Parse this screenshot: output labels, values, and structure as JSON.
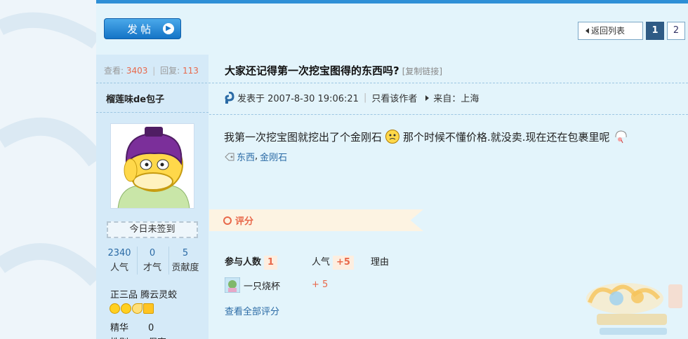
{
  "toolbar": {
    "post_label": "发帖",
    "back_label": "返回列表",
    "pages": [
      "1",
      "2"
    ],
    "current_page": "1"
  },
  "thread": {
    "stats": {
      "views_label": "查看:",
      "views": "3403",
      "replies_label": "回复:",
      "replies": "113"
    },
    "title": "大家还记得第一次挖宝图得的东西吗?",
    "copy_link": "[复制链接]"
  },
  "author": {
    "name": "榴莲味de包子",
    "checkin": "今日未签到",
    "stats": [
      {
        "value": "2340",
        "label": "人气"
      },
      {
        "value": "0",
        "label": "才气"
      },
      {
        "value": "5",
        "label": "贡献度"
      }
    ],
    "rank": "正三品 腾云灵蛟",
    "details": [
      {
        "label": "精华",
        "value": "0"
      },
      {
        "label": "性别",
        "value": "保密"
      }
    ]
  },
  "post": {
    "posted_at": "发表于 2007-8-30 19:06:21",
    "only_author": "只看该作者",
    "from": "来自：上海",
    "content_part1": "我第一次挖宝图就挖出了个金刚石",
    "content_part2": "那个时候不懂价格.就没卖.现在还在包裹里呢",
    "tags": [
      "东西",
      "金刚石"
    ],
    "tag_separator": ","
  },
  "rating": {
    "section_label": "评分",
    "participants_label": "参与人数",
    "participants": "1",
    "popularity_label": "人气",
    "popularity_total": "+5",
    "reason_label": "理由",
    "entries": [
      {
        "user": "一只烧杯",
        "score": "+ 5"
      }
    ],
    "view_all": "查看全部评分"
  },
  "colors": {
    "accent": "#2e8fd6",
    "score": "#e8684a",
    "link": "#2a6aa5"
  }
}
